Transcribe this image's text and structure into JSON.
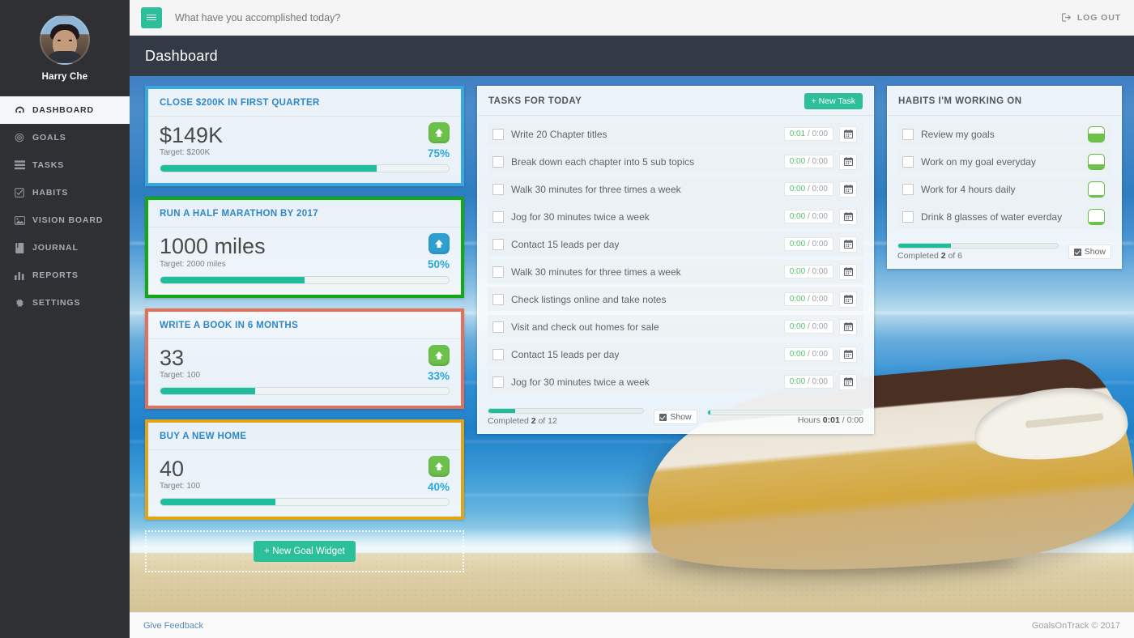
{
  "sidebar": {
    "user_name": "Harry Che",
    "items": [
      {
        "label": "DASHBOARD",
        "icon": "dashboard-icon",
        "active": true
      },
      {
        "label": "GOALS",
        "icon": "target-icon",
        "active": false
      },
      {
        "label": "TASKS",
        "icon": "list-icon",
        "active": false
      },
      {
        "label": "HABITS",
        "icon": "check-square-icon",
        "active": false
      },
      {
        "label": "VISION BOARD",
        "icon": "image-icon",
        "active": false
      },
      {
        "label": "JOURNAL",
        "icon": "book-icon",
        "active": false
      },
      {
        "label": "REPORTS",
        "icon": "bar-chart-icon",
        "active": false
      },
      {
        "label": "SETTINGS",
        "icon": "gear-icon",
        "active": false
      }
    ]
  },
  "topbar": {
    "menu_icon": "hamburger-icon",
    "prompt_placeholder": "What have you accomplished today?",
    "prompt_value": "",
    "logout_label": "LOG OUT",
    "logout_icon": "sign-out-icon"
  },
  "page": {
    "title": "Dashboard"
  },
  "goals": [
    {
      "title": "CLOSE $200K IN FIRST QUARTER",
      "value": "$149K",
      "target": "Target: $200K",
      "percent_label": "75%",
      "percent": 75,
      "border_color": "#3aa8dd",
      "badge_color": "#6cc14a",
      "arrow_icon": "arrow-up-icon"
    },
    {
      "title": "RUN A HALF MARATHON BY 2017",
      "value": "1000 miles",
      "target": "Target: 2000 miles",
      "percent_label": "50%",
      "percent": 50,
      "border_color": "#14a814",
      "badge_color": "#2f9fd0",
      "arrow_icon": "arrow-up-icon"
    },
    {
      "title": "WRITE A BOOK IN 6 MONTHS",
      "value": "33",
      "target": "Target: 100",
      "percent_label": "33%",
      "percent": 33,
      "border_color": "#e4705a",
      "badge_color": "#6cc14a",
      "arrow_icon": "arrow-up-icon"
    },
    {
      "title": "BUY A NEW HOME",
      "value": "40",
      "target": "Target: 100",
      "percent_label": "40%",
      "percent": 40,
      "border_color": "#e0a417",
      "badge_color": "#6cc14a",
      "arrow_icon": "arrow-up-icon"
    }
  ],
  "new_goal_widget": {
    "label": "+ New Goal Widget"
  },
  "tasks_panel": {
    "title": "TASKS FOR TODAY",
    "new_task_label": "+ New Task",
    "rows": [
      {
        "text": "Write 20 Chapter titles",
        "elapsed": "0:01",
        "planned": "0:00",
        "checked": false
      },
      {
        "text": "Break down each chapter into 5 sub topics",
        "elapsed": "0:00",
        "planned": "0:00",
        "checked": false
      },
      {
        "text": "Walk 30 minutes for three times a week",
        "elapsed": "0:00",
        "planned": "0:00",
        "checked": false
      },
      {
        "text": "Jog for 30 minutes twice a week",
        "elapsed": "0:00",
        "planned": "0:00",
        "checked": false
      },
      {
        "text": "Contact 15 leads per day",
        "elapsed": "0:00",
        "planned": "0:00",
        "checked": false
      },
      {
        "text": "Walk 30 minutes for three times a week",
        "elapsed": "0:00",
        "planned": "0:00",
        "checked": false
      },
      {
        "text": "Check listings online and take notes",
        "elapsed": "0:00",
        "planned": "0:00",
        "checked": false
      },
      {
        "text": "Visit and check out homes for sale",
        "elapsed": "0:00",
        "planned": "0:00",
        "checked": false
      },
      {
        "text": "Contact 15 leads per day",
        "elapsed": "0:00",
        "planned": "0:00",
        "checked": false
      },
      {
        "text": "Jog for 30 minutes twice a week",
        "elapsed": "0:00",
        "planned": "0:00",
        "checked": false
      }
    ],
    "footer": {
      "completed_prefix": "Completed",
      "completed_count": "2",
      "completed_suffix": "of 12",
      "completed_percent": 17,
      "show_label": "Show",
      "show_checked": true,
      "hours_prefix": "Hours",
      "hours_done": "0:01",
      "hours_total": "0:00",
      "hours_percent": 2
    }
  },
  "habits_panel": {
    "title": "HABITS I'M WORKING ON",
    "rows": [
      {
        "text": "Review my goals",
        "checked": false,
        "fill": 55,
        "icon": "habit-progress-icon"
      },
      {
        "text": "Work on my goal everyday",
        "checked": false,
        "fill": 32,
        "icon": "habit-progress-icon"
      },
      {
        "text": "Work for 4 hours daily",
        "checked": false,
        "fill": 6,
        "icon": "habit-progress-icon"
      },
      {
        "text": "Drink 8 glasses of water everday",
        "checked": false,
        "fill": 14,
        "icon": "habit-progress-icon"
      }
    ],
    "footer": {
      "completed_prefix": "Completed",
      "completed_count": "2",
      "completed_suffix": "of 6",
      "completed_percent": 33,
      "show_label": "Show",
      "show_checked": true
    }
  },
  "footer": {
    "feedback_label": "Give Feedback",
    "copyright": "GoalsOnTrack © 2017"
  },
  "colors": {
    "accent_green": "#2dbf9a",
    "progress_teal": "#1fbd9c",
    "link_blue": "#2f87c9",
    "sidebar_bg": "#2e3033",
    "pagehead_bg": "#333a45"
  }
}
